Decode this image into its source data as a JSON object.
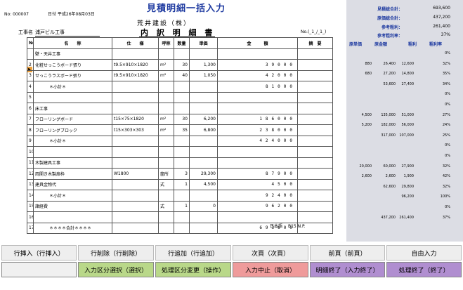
{
  "header": {
    "title": "見積明細一括入力",
    "doc_no": "No: 000007",
    "date": "日付 平成26年08月03日",
    "company": "荒井建設（株）",
    "sheet_title": "内 訳 明 細 書",
    "client_prefix": "工事名",
    "client_name": "浦戸ビル工事",
    "page_mark": "No.(_1_/_1_)"
  },
  "summary": {
    "rows": [
      {
        "label": "見積総合計：",
        "value": "693,600"
      },
      {
        "label": "原価総合計：",
        "value": "437,200"
      },
      {
        "label": "参考粗利：",
        "value": "261,400"
      },
      {
        "label": "参考粗利率：",
        "value": "37%"
      }
    ],
    "col_headers": [
      "原単価",
      "原金額",
      "粗利",
      "粗利率"
    ]
  },
  "table": {
    "headers": [
      "No",
      "名　　称",
      "仕　　様",
      "呼称",
      "数量",
      "単価",
      "金　　　額",
      "摘　要"
    ],
    "rows": [
      {
        "no": "",
        "name": "壁・天井工事",
        "spec": "",
        "unit": "",
        "qty": "",
        "price": "",
        "amount": "",
        "cat": true
      },
      {
        "no": "2",
        "name": "化粧せっこうボード張り",
        "spec": "t9.5×910×1820",
        "unit": "m²",
        "qty": "30",
        "price": "1,300",
        "amount": "39000"
      },
      {
        "no": "3",
        "name": "せっこうラスボード張り",
        "spec": "t9.5×910×1820",
        "unit": "m²",
        "qty": "40",
        "price": "1,050",
        "amount": "42000"
      },
      {
        "no": "4",
        "name": "＊小計＊",
        "spec": "",
        "unit": "",
        "qty": "",
        "price": "",
        "amount": "81000",
        "sub": true
      },
      {
        "no": "5",
        "name": "",
        "spec": "",
        "unit": "",
        "qty": "",
        "price": "",
        "amount": ""
      },
      {
        "no": "6",
        "name": "床工事",
        "spec": "",
        "unit": "",
        "qty": "",
        "price": "",
        "amount": "",
        "cat": true
      },
      {
        "no": "7",
        "name": "フローリングボード",
        "spec": "t15×75×1820",
        "unit": "m²",
        "qty": "30",
        "price": "6,200",
        "amount": "186000"
      },
      {
        "no": "8",
        "name": "フローリングブロック",
        "spec": "t15×303×303",
        "unit": "m²",
        "qty": "35",
        "price": "6,800",
        "amount": "238000"
      },
      {
        "no": "9",
        "name": "＊小計＊",
        "spec": "",
        "unit": "",
        "qty": "",
        "price": "",
        "amount": "424000",
        "sub": true
      },
      {
        "no": "10",
        "name": "",
        "spec": "",
        "unit": "",
        "qty": "",
        "price": "",
        "amount": ""
      },
      {
        "no": "11",
        "name": "木製建具工事",
        "spec": "",
        "unit": "",
        "qty": "",
        "price": "",
        "amount": "",
        "cat": true
      },
      {
        "no": "12",
        "name": "両開き木製扉枠",
        "spec": "W1800",
        "unit": "箇所",
        "qty": "3",
        "price": "29,300",
        "amount": "87900"
      },
      {
        "no": "13",
        "name": "建具金物代",
        "spec": "",
        "unit": "式",
        "qty": "1",
        "price": "4,500",
        "amount": "4500"
      },
      {
        "no": "14",
        "name": "＊小計＊",
        "spec": "",
        "unit": "",
        "qty": "",
        "price": "",
        "amount": "92400",
        "sub": true
      },
      {
        "no": "15",
        "name": "諸経費",
        "spec": "",
        "unit": "式",
        "qty": "1",
        "price": "0",
        "amount": "96200"
      },
      {
        "no": "16",
        "name": "",
        "spec": "",
        "unit": "",
        "qty": "",
        "price": "",
        "amount": ""
      },
      {
        "no": "17",
        "name": "＊＊＊＊合計＊＊＊＊",
        "spec": "",
        "unit": "",
        "qty": "",
        "price": "",
        "amount": "693600",
        "sub": true
      }
    ],
    "footer": "日本語",
    "footer2": "B15 N.P."
  },
  "cost_rows": [
    {
      "row": 1,
      "vals": [
        "",
        "",
        "",
        "0%"
      ]
    },
    {
      "row": 2,
      "vals": [
        "880",
        "26,400",
        "12,600",
        "32%"
      ]
    },
    {
      "row": 3,
      "vals": [
        "680",
        "27,200",
        "14,800",
        "35%"
      ]
    },
    {
      "row": 4,
      "vals": [
        "",
        "53,600",
        "27,400",
        "34%"
      ]
    },
    {
      "row": 5,
      "vals": [
        "",
        "",
        "",
        "0%"
      ]
    },
    {
      "row": 6,
      "vals": [
        "",
        "",
        "",
        "0%"
      ]
    },
    {
      "row": 7,
      "vals": [
        "4,500",
        "135,000",
        "51,000",
        "27%"
      ]
    },
    {
      "row": 8,
      "vals": [
        "5,200",
        "182,000",
        "56,000",
        "24%"
      ]
    },
    {
      "row": 9,
      "vals": [
        "",
        "317,000",
        "107,000",
        "25%"
      ]
    },
    {
      "row": 10,
      "vals": [
        "",
        "",
        "",
        "0%"
      ]
    },
    {
      "row": 11,
      "vals": [
        "",
        "",
        "",
        "0%"
      ]
    },
    {
      "row": 12,
      "vals": [
        "20,000",
        "60,000",
        "27,900",
        "32%"
      ]
    },
    {
      "row": 13,
      "vals": [
        "2,600",
        "2,600",
        "1,900",
        "42%"
      ]
    },
    {
      "row": 14,
      "vals": [
        "",
        "62,600",
        "29,800",
        "32%"
      ]
    },
    {
      "row": 15,
      "vals": [
        "",
        "",
        "96,200",
        "100%"
      ]
    },
    {
      "row": 16,
      "vals": [
        "",
        "",
        "",
        "0%"
      ]
    },
    {
      "row": 17,
      "vals": [
        "",
        "437,200",
        "261,400",
        "37%"
      ]
    }
  ],
  "buttons_top": [
    "行挿入（行挿入）",
    "行削除（行削除）",
    "行追加（行追加）",
    "次頁（次頁）",
    "前頁（前頁）",
    "自由入力"
  ],
  "buttons_bottom": [
    "",
    "入力区分選択（選択）",
    "処理区分変更（操作）",
    "入力中止（取消）",
    "明細終了（入力終了）",
    "処理終了（終了）"
  ]
}
